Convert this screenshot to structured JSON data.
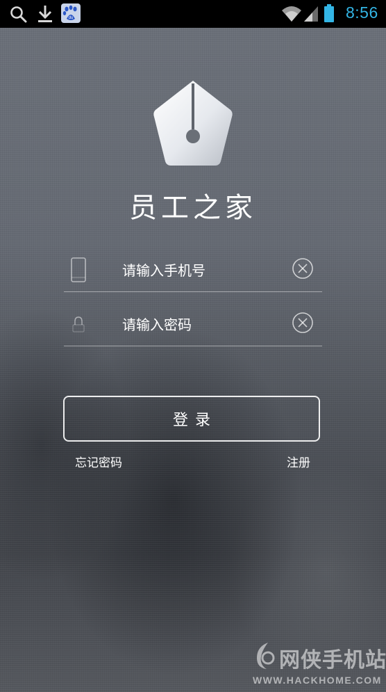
{
  "status_bar": {
    "time": "8:56",
    "icons": [
      "search-icon",
      "download-icon",
      "baidu-icon",
      "wifi-icon",
      "signal-icon",
      "battery-icon"
    ],
    "time_color": "#33b5e5"
  },
  "app": {
    "title": "员工之家",
    "logo_icon": "pen-nib-pentagon-icon"
  },
  "form": {
    "phone": {
      "value": "",
      "placeholder": "请输入手机号",
      "icon": "phone-icon",
      "clear_icon": "clear-circle-x-icon"
    },
    "password": {
      "value": "",
      "placeholder": "请输入密码",
      "icon": "lock-icon",
      "clear_icon": "clear-circle-x-icon"
    },
    "login_label": "登录",
    "forgot_label": "忘记密码",
    "register_label": "注册"
  },
  "watermark": {
    "text": "网侠手机站",
    "url": "WWW.HACKHOME.COM"
  }
}
